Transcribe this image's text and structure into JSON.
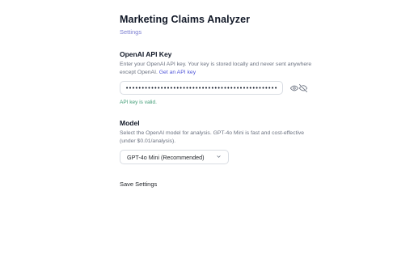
{
  "page": {
    "title": "Marketing Claims Analyzer",
    "settings_link": "Settings"
  },
  "api_key": {
    "heading": "OpenAI API Key",
    "description": "Enter your OpenAI API key. Your key is stored locally and never sent anywhere except OpenAI.",
    "get_key_link": "Get an API key",
    "value": "••••••••••••••••••••••••••••••••••••••••••••••••",
    "status": "API key is valid.",
    "status_color": "#3e9b74",
    "icons": [
      "eye-icon",
      "eye-off-icon"
    ]
  },
  "model": {
    "heading": "Model",
    "description": "Select the OpenAI model for analysis. GPT-4o Mini is fast and cost-effective (under $0.01/analysis).",
    "selected": "GPT-4o Mini (Recommended)",
    "icon": "chevron-down-icon"
  },
  "actions": {
    "save_label": "Save Settings"
  },
  "colors": {
    "link": "#4f55d8",
    "settings_link": "#7c7fd1"
  }
}
